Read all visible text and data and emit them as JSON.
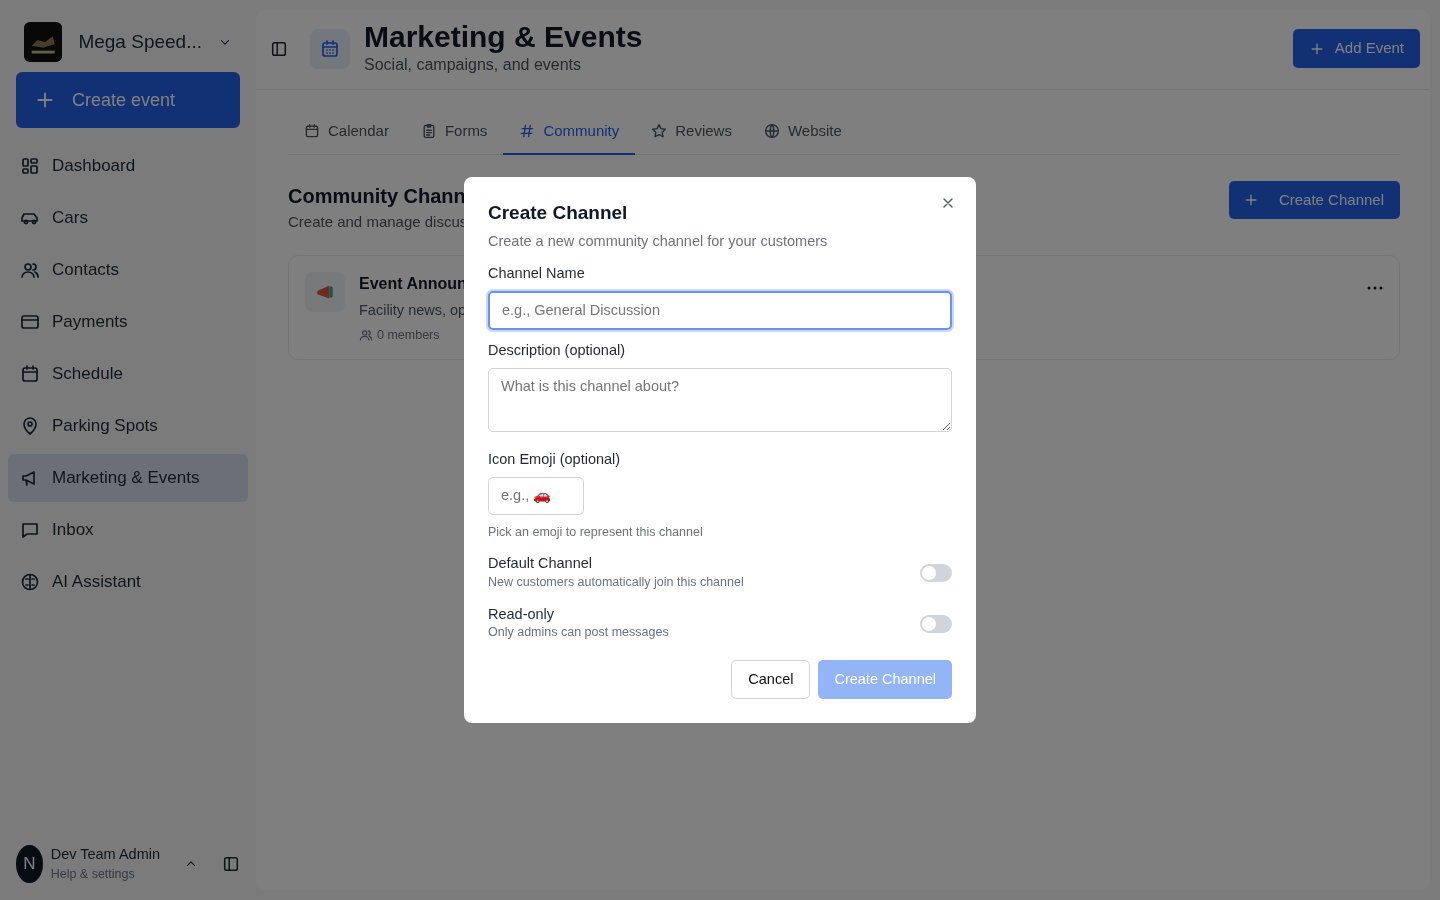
{
  "sidebar": {
    "org_name": "Mega Speed...",
    "create_button": "Create event",
    "items": [
      {
        "label": "Dashboard",
        "selected": false
      },
      {
        "label": "Cars",
        "selected": false
      },
      {
        "label": "Contacts",
        "selected": false
      },
      {
        "label": "Payments",
        "selected": false
      },
      {
        "label": "Schedule",
        "selected": false
      },
      {
        "label": "Parking Spots",
        "selected": false
      },
      {
        "label": "Marketing & Events",
        "selected": true
      },
      {
        "label": "Inbox",
        "selected": false
      },
      {
        "label": "AI Assistant",
        "selected": false
      }
    ],
    "user": {
      "avatar": "N",
      "name": "Dev Team Admin",
      "subtitle": "Help & settings"
    }
  },
  "header": {
    "title": "Marketing & Events",
    "subtitle": "Social, campaigns, and events",
    "add_button": "Add Event"
  },
  "tabs": [
    {
      "label": "Calendar",
      "selected": false
    },
    {
      "label": "Forms",
      "selected": false
    },
    {
      "label": "Community",
      "selected": true
    },
    {
      "label": "Reviews",
      "selected": false
    },
    {
      "label": "Website",
      "selected": false
    }
  ],
  "section": {
    "title": "Community Chann",
    "subtitle": "Create and manage discus",
    "create_button": "Create Channel"
  },
  "channels": [
    {
      "name": "Event Announ",
      "description": "Facility news, op",
      "members": "0 members"
    }
  ],
  "modal": {
    "title": "Create Channel",
    "subtitle": "Create a new community channel for your customers",
    "fields": [
      {
        "label": "Channel Name",
        "placeholder": "e.g., General Discussion",
        "kind": "input",
        "focused": true
      },
      {
        "label": "Description (optional)",
        "placeholder": "What is this channel about?",
        "kind": "textarea",
        "focused": false
      },
      {
        "label": "Icon Emoji (optional)",
        "placeholder": "e.g., 🚗",
        "kind": "emoji",
        "focused": false,
        "help": "Pick an emoji to represent this channel"
      }
    ],
    "toggles": [
      {
        "label": "Default Channel",
        "description": "New customers automatically join this channel",
        "on": false
      },
      {
        "label": "Read-only",
        "description": "Only admins can post messages",
        "on": false
      }
    ],
    "cancel_button": "Cancel",
    "submit_button": {
      "label": "Create Channel",
      "disabled": true
    }
  }
}
